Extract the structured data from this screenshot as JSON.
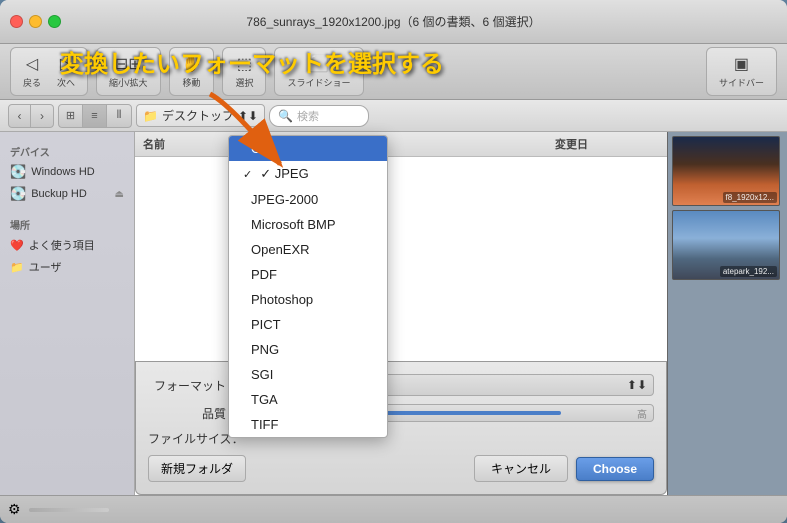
{
  "window": {
    "title": "786_sunrays_1920x1200.jpg（6 個の書類、6 個選択）"
  },
  "toolbar": {
    "back": "戻る",
    "forward": "次へ",
    "zoom_label": "縮小/拡大",
    "move_label": "移動",
    "select_label": "選択",
    "slideshow_label": "スライドショー",
    "sidebar_label": "サイドバー"
  },
  "navbar": {
    "path": "デスクトップ",
    "search_placeholder": "検索"
  },
  "sidebar": {
    "devices_label": "デバイス",
    "items": [
      {
        "label": "Windows HD",
        "icon": "💽"
      },
      {
        "label": "Buckup HD",
        "icon": "💽"
      }
    ],
    "places_label": "場所",
    "places": [
      {
        "label": "よく使う項目",
        "icon": "❤️"
      },
      {
        "label": "ユーザ",
        "icon": "📁"
      }
    ]
  },
  "file_list": {
    "col_name": "名前",
    "col_date": "変更日"
  },
  "thumbnails": [
    {
      "label": "f8_1920x12..."
    },
    {
      "label": "atepark_192..."
    }
  ],
  "annotation": {
    "text": "変換したいフォーマットを選択する"
  },
  "dialog": {
    "format_label": "フォーマット：",
    "quality_label": "品質：",
    "filesize_label": "ファイルサイズ：",
    "new_folder": "新規フォルダ",
    "cancel": "キャンセル",
    "choose": "Choose"
  },
  "dropdown": {
    "items": [
      {
        "label": "GIF",
        "selected": true,
        "checked": false
      },
      {
        "label": "JPEG",
        "selected": false,
        "checked": true
      },
      {
        "label": "JPEG-2000",
        "selected": false,
        "checked": false
      },
      {
        "label": "Microsoft BMP",
        "selected": false,
        "checked": false
      },
      {
        "label": "OpenEXR",
        "selected": false,
        "checked": false
      },
      {
        "label": "PDF",
        "selected": false,
        "checked": false
      },
      {
        "label": "Photoshop",
        "selected": false,
        "checked": false
      },
      {
        "label": "PICT",
        "selected": false,
        "checked": false
      },
      {
        "label": "PNG",
        "selected": false,
        "checked": false
      },
      {
        "label": "SGI",
        "selected": false,
        "checked": false
      },
      {
        "label": "TGA",
        "selected": false,
        "checked": false
      },
      {
        "label": "TIFF",
        "selected": false,
        "checked": false
      }
    ]
  }
}
